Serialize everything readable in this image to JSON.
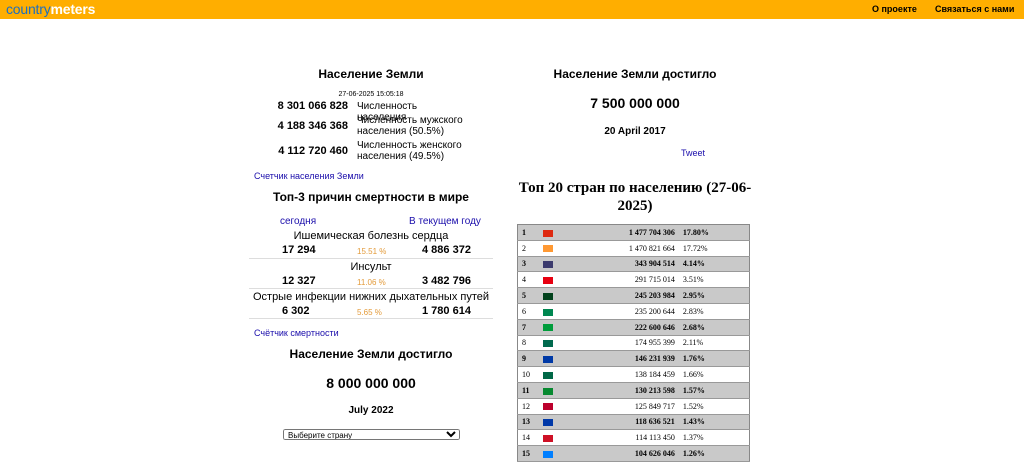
{
  "header": {
    "logo_part1": "country",
    "logo_part2": "meters",
    "nav_about": "О проекте",
    "nav_contact": "Связаться с нами"
  },
  "world": {
    "title": "Население Земли",
    "timestamp": "27-06-2025 15:05:18",
    "stats": [
      {
        "value": "8 301 066 828",
        "label": "Численность населения"
      },
      {
        "value": "4 188 346 368",
        "label": "Численность мужского населения (50.5%)"
      },
      {
        "value": "4 112 720 460",
        "label": "Численность женского населения (49.5%)"
      }
    ],
    "counter_link": "Счетчик населения Земли"
  },
  "deaths": {
    "title": "Топ-3 причин смертности в мире",
    "col_today": "сегодня",
    "col_year": "В текущем году",
    "rows": [
      {
        "name": "Ишемическая болезнь сердца",
        "today": "17 294",
        "pct": "15.51 %",
        "year": "4 886 372"
      },
      {
        "name": "Инсульт",
        "today": "12 327",
        "pct": "11.06 %",
        "year": "3 482 796"
      },
      {
        "name": "Острые инфекции нижних дыхательных путей",
        "today": "6 302",
        "pct": "5.65 %",
        "year": "1 780 614"
      }
    ],
    "counter_link": "Счётчик смертности"
  },
  "milestone8": {
    "title": "Население Земли достигло",
    "value": "8 000 000 000",
    "date": "July 2022"
  },
  "select": {
    "selected": "Выберите страну"
  },
  "milestone75": {
    "title": "Население Земли достигло",
    "value": "7 500 000 000",
    "date": "20 April 2017",
    "tweet": "Tweet"
  },
  "top20": {
    "title": "Топ 20 стран по населению (27-06-2025)",
    "rows": [
      {
        "rank": "1",
        "flag": "#de2910",
        "pop": "1 477 704 306",
        "pct": "17.80%"
      },
      {
        "rank": "2",
        "flag": "#ff9933",
        "pop": "1 470 821 664",
        "pct": "17.72%"
      },
      {
        "rank": "3",
        "flag": "#3c3b6e",
        "pop": "343 904 514",
        "pct": "4.14%"
      },
      {
        "rank": "4",
        "flag": "#e70011",
        "pop": "291 715 014",
        "pct": "3.51%"
      },
      {
        "rank": "5",
        "flag": "#01411c",
        "pop": "245 203 984",
        "pct": "2.95%"
      },
      {
        "rank": "6",
        "flag": "#008751",
        "pop": "235 200 644",
        "pct": "2.83%"
      },
      {
        "rank": "7",
        "flag": "#009c3b",
        "pop": "222 600 646",
        "pct": "2.68%"
      },
      {
        "rank": "8",
        "flag": "#006a4e",
        "pop": "174 955 399",
        "pct": "2.11%"
      },
      {
        "rank": "9",
        "flag": "#0039a6",
        "pop": "146 231 939",
        "pct": "1.76%"
      },
      {
        "rank": "10",
        "flag": "#006847",
        "pop": "138 184 459",
        "pct": "1.66%"
      },
      {
        "rank": "11",
        "flag": "#078930",
        "pop": "130 213 598",
        "pct": "1.57%"
      },
      {
        "rank": "12",
        "flag": "#bc002d",
        "pop": "125 849 717",
        "pct": "1.52%"
      },
      {
        "rank": "13",
        "flag": "#0038a8",
        "pop": "118 636 521",
        "pct": "1.43%"
      },
      {
        "rank": "14",
        "flag": "#ce1126",
        "pop": "114 113 450",
        "pct": "1.37%"
      },
      {
        "rank": "15",
        "flag": "#007fff",
        "pop": "104 626 046",
        "pct": "1.26%"
      }
    ]
  }
}
